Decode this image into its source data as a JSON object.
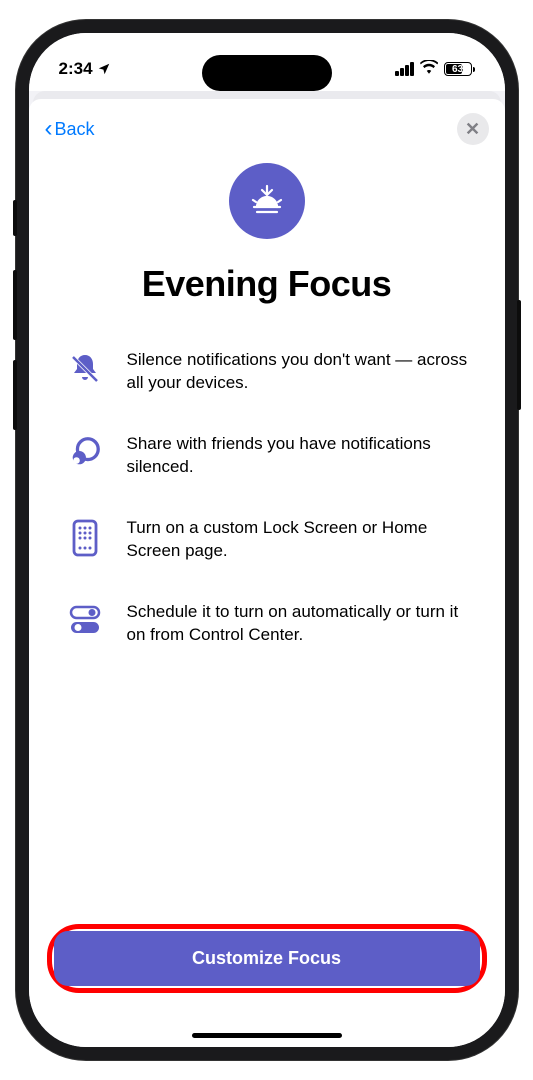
{
  "status": {
    "time": "2:34",
    "battery": "63"
  },
  "nav": {
    "back_label": "Back"
  },
  "title": "Evening Focus",
  "features": [
    {
      "text": "Silence notifications you don't want — across all your devices."
    },
    {
      "text": "Share with friends you have notifications silenced."
    },
    {
      "text": "Turn on a custom Lock Screen or Home Screen page."
    },
    {
      "text": "Schedule it to turn on automatically or turn it on from Control Center."
    }
  ],
  "cta": {
    "label": "Customize Focus"
  },
  "colors": {
    "accent": "#5d5ec7",
    "link": "#007aff",
    "highlight": "#ff0000"
  }
}
